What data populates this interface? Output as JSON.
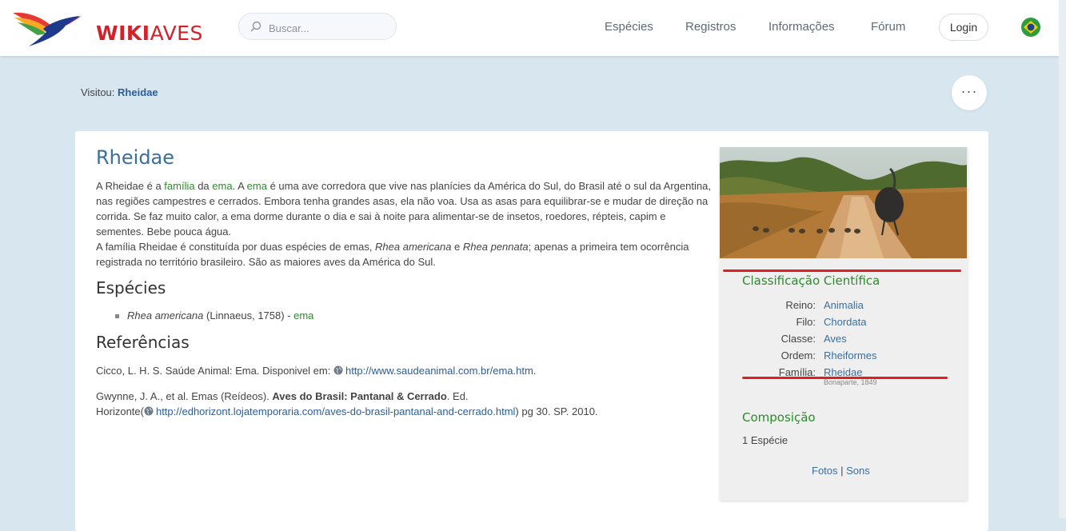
{
  "header": {
    "logo_wiki": "WIKI",
    "logo_aves": "AVES",
    "search_placeholder": "Buscar...",
    "nav": [
      "Espécies",
      "Registros",
      "Informações",
      "Fórum"
    ],
    "login": "Login"
  },
  "breadcrumb": {
    "prefix": "Visitou:",
    "link": "Rheidae",
    "more": "···"
  },
  "article": {
    "title": "Rheidae",
    "desc": {
      "p1_a": "A Rheidae é a ",
      "p1_link1": "família",
      "p1_b": " da ",
      "p1_link2": "ema",
      "p1_c": ". A ",
      "p1_link3": "ema",
      "p1_d": " é uma ave corredora que vive nas planícies da América do Sul, do Brasil até o sul da Argentina, nas regiões campestres e cerrados. Embora tenha grandes asas, ela não voa. Usa as asas para equilibrar-se e mudar de direção na corrida. Se faz muito calor, a ema dorme durante o dia e sai à noite para alimentar-se de insetos, roedores, répteis, capim e sementes. Bebe pouca água.",
      "p2_a": "A família Rheidae é constituída por duas espécies de emas, ",
      "p2_i1": "Rhea americana",
      "p2_b": " e ",
      "p2_i2": "Rhea pennata",
      "p2_c": "; apenas a primeira tem ocorrência registrada no território brasileiro. São as maiores aves da América do Sul."
    },
    "species_heading": "Espécies",
    "species": {
      "sci": "Rhea americana",
      "authority": " (Linnaeus, 1758) - ",
      "common": "ema"
    },
    "refs_heading": "Referências",
    "ref1": {
      "text": "Cicco, L. H. S. Saúde Animal: Ema. Disponivel em: ",
      "url": "http://www.saudeanimal.com.br/ema.htm",
      "end": "."
    },
    "ref2": {
      "text_a": "Gwynne, J. A., et al. Emas (Reídeos). ",
      "bold": "Aves do Brasil: Pantanal & Cerrado",
      "text_b": ". Ed.",
      "line2_a": "Horizonte(",
      "url": "http://edhorizont.lojatemporaria.com/aves-do-brasil-pantanal-and-cerrado.html",
      "line2_b": ") pg 30. SP. 2010."
    }
  },
  "sidebar": {
    "classification_title": "Classificação Científica",
    "taxonomy": [
      {
        "label": "Reino:",
        "value": "Animalia"
      },
      {
        "label": "Filo:",
        "value": "Chordata"
      },
      {
        "label": "Classe:",
        "value": "Aves"
      },
      {
        "label": "Ordem:",
        "value": "Rheiformes"
      },
      {
        "label": "Família:",
        "value": "Rheidae"
      }
    ],
    "author": "Bonaparte, 1849",
    "composition_title": "Composição",
    "composition_count": "1 Espécie",
    "media_photos": "Fotos",
    "media_sep": " | ",
    "media_sounds": "Sons"
  },
  "colors": {
    "accent_green": "#2e8a2e",
    "link_blue": "#3a6f9c",
    "logo_red": "#d3212a",
    "annotation_red": "#e02020"
  }
}
